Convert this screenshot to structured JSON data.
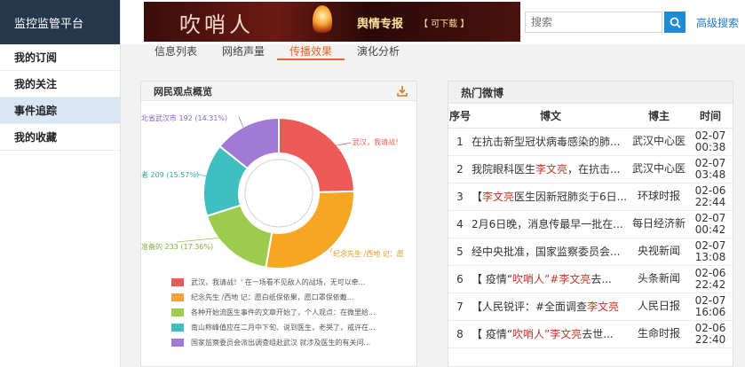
{
  "sidebar": {
    "brand": "监控监管平台",
    "items": [
      {
        "label": "我的订阅",
        "active": false
      },
      {
        "label": "我的关注",
        "active": false
      },
      {
        "label": "事件追踪",
        "active": true
      },
      {
        "label": "我的收藏",
        "active": false
      }
    ]
  },
  "header": {
    "banner_title": "吹哨人",
    "banner_tag": "舆情专报",
    "banner_tag_sub": "【 可下载 】",
    "search_placeholder": "搜索",
    "advanced_search": "高级搜索"
  },
  "tabs": [
    {
      "label": "信息列表",
      "active": false
    },
    {
      "label": "网络声量",
      "active": false
    },
    {
      "label": "传播效果",
      "active": true
    },
    {
      "label": "演化分析",
      "active": false
    }
  ],
  "opinion_panel": {
    "title": "网民观点概览",
    "labels": {
      "red": "武汉，我请战！",
      "orange": "纪念先生 /西地 记：愿",
      "green": "准备的 233 (17.36%)",
      "teal": "者 209 (15.57%)",
      "purple": "北省武汉市 192 (14.31%)"
    },
    "legend": [
      {
        "text": "武汉，我请战！'     在一场看不见敌人的战场，无可以牵...",
        "color": "#ee5a55"
      },
      {
        "text": "纪念先生 /西地  记：愿白纸保依果，愿口罩保依戴...",
        "color": "#f5a623"
      },
      {
        "text": "各种开始流医生事件的文章开始了，个人观点：在微里给...",
        "color": "#9ccb4e"
      },
      {
        "text": "南山称峰值应在二月中下旬、说到医生，老哭了，戒许在...",
        "color": "#3fbfbf"
      },
      {
        "text": "国家监察委员会派出调查组赴武汉 就涉及医生的有关问...",
        "color": "#a07ad6"
      }
    ]
  },
  "chart_data": {
    "type": "pie",
    "donut": true,
    "title": "网民观点概览",
    "slices": [
      {
        "name": "武汉，我请战！",
        "value": 330,
        "percent": 24.6,
        "color": "#ee5a55"
      },
      {
        "name": "纪念先生 /西地 记：愿",
        "value": 378,
        "percent": 28.17,
        "color": "#f5a623"
      },
      {
        "name": "准备的",
        "value": 233,
        "percent": 17.36,
        "color": "#9ccb4e"
      },
      {
        "name": "者",
        "value": 209,
        "percent": 15.57,
        "color": "#3fbfbf"
      },
      {
        "name": "北省武汉市",
        "value": 192,
        "percent": 14.31,
        "color": "#a07ad6"
      }
    ]
  },
  "hot_weibo": {
    "title": "热门微博",
    "columns": [
      "序号",
      "博文",
      "博主",
      "时间"
    ],
    "rows": [
      {
        "idx": "1",
        "pre": "在抗击新型冠状病毒感染的肺...",
        "hl": "",
        "post": "",
        "author": "武汉中心医",
        "date": "02-07",
        "time": "00:38"
      },
      {
        "idx": "2",
        "pre": "我院眼科医生",
        "hl": "李文亮",
        "post": "，在抗击...",
        "author": "武汉中心医",
        "date": "02-07",
        "time": "03:48"
      },
      {
        "idx": "3",
        "pre": "【",
        "hl": "李文亮",
        "post": "医生因新冠肺炎于6日...",
        "author": "环球时报",
        "date": "02-06",
        "time": "22:44"
      },
      {
        "idx": "4",
        "pre": "2月6日晚，消息传最早一批在...",
        "hl": "",
        "post": "",
        "author": "每日经济新",
        "date": "02-07",
        "time": "00:42"
      },
      {
        "idx": "5",
        "pre": "经中央批准，国家监察委员会...",
        "hl": "",
        "post": "",
        "author": "央视新闻",
        "date": "02-07",
        "time": "13:08"
      },
      {
        "idx": "6",
        "pre": "【 疫情“",
        "hl": "吹哨人”#李文亮",
        "post": "去...",
        "author": "头条新闻",
        "date": "02-06",
        "time": "22:42"
      },
      {
        "idx": "7",
        "pre": "【人民锐评：#全面调查",
        "hl": "李文亮",
        "post": "",
        "author": "人民日报",
        "date": "02-07",
        "time": "16:06"
      },
      {
        "idx": "8",
        "pre": "【 疫情“",
        "hl": "吹哨人”李文亮",
        "post": "去世...",
        "author": "生命时报",
        "date": "02-06",
        "time": "22:40"
      }
    ]
  }
}
